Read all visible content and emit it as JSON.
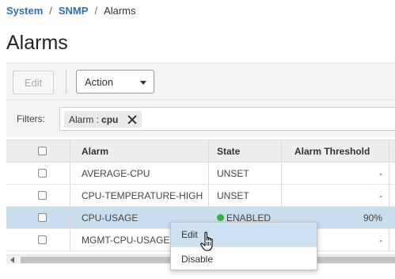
{
  "breadcrumb": {
    "items": [
      {
        "label": "System"
      },
      {
        "label": "SNMP"
      },
      {
        "label": "Alarms"
      }
    ],
    "separator": "/"
  },
  "page": {
    "title": "Alarms"
  },
  "toolbar": {
    "edit_label": "Edit",
    "action_label": "Action"
  },
  "filters": {
    "label": "Filters:",
    "chip": {
      "key": "Alarm :",
      "value": "cpu"
    }
  },
  "table": {
    "columns": [
      "Alarm",
      "State",
      "Alarm Threshold"
    ],
    "rows": [
      {
        "alarm": "AVERAGE-CPU",
        "state": "UNSET",
        "threshold": "-"
      },
      {
        "alarm": "CPU-TEMPERATURE-HIGH",
        "state": "UNSET",
        "threshold": "-"
      },
      {
        "alarm": "CPU-USAGE",
        "state": "ENABLED",
        "threshold": "90%"
      },
      {
        "alarm": "MGMT-CPU-USAGE",
        "state": "",
        "threshold": "-"
      }
    ]
  },
  "context_menu": {
    "items": [
      {
        "label": "Edit"
      },
      {
        "label": "Disable"
      }
    ]
  },
  "colors": {
    "link": "#2a6ebb",
    "selected_row": "#c8dff0",
    "enabled_dot": "#3cb043"
  }
}
